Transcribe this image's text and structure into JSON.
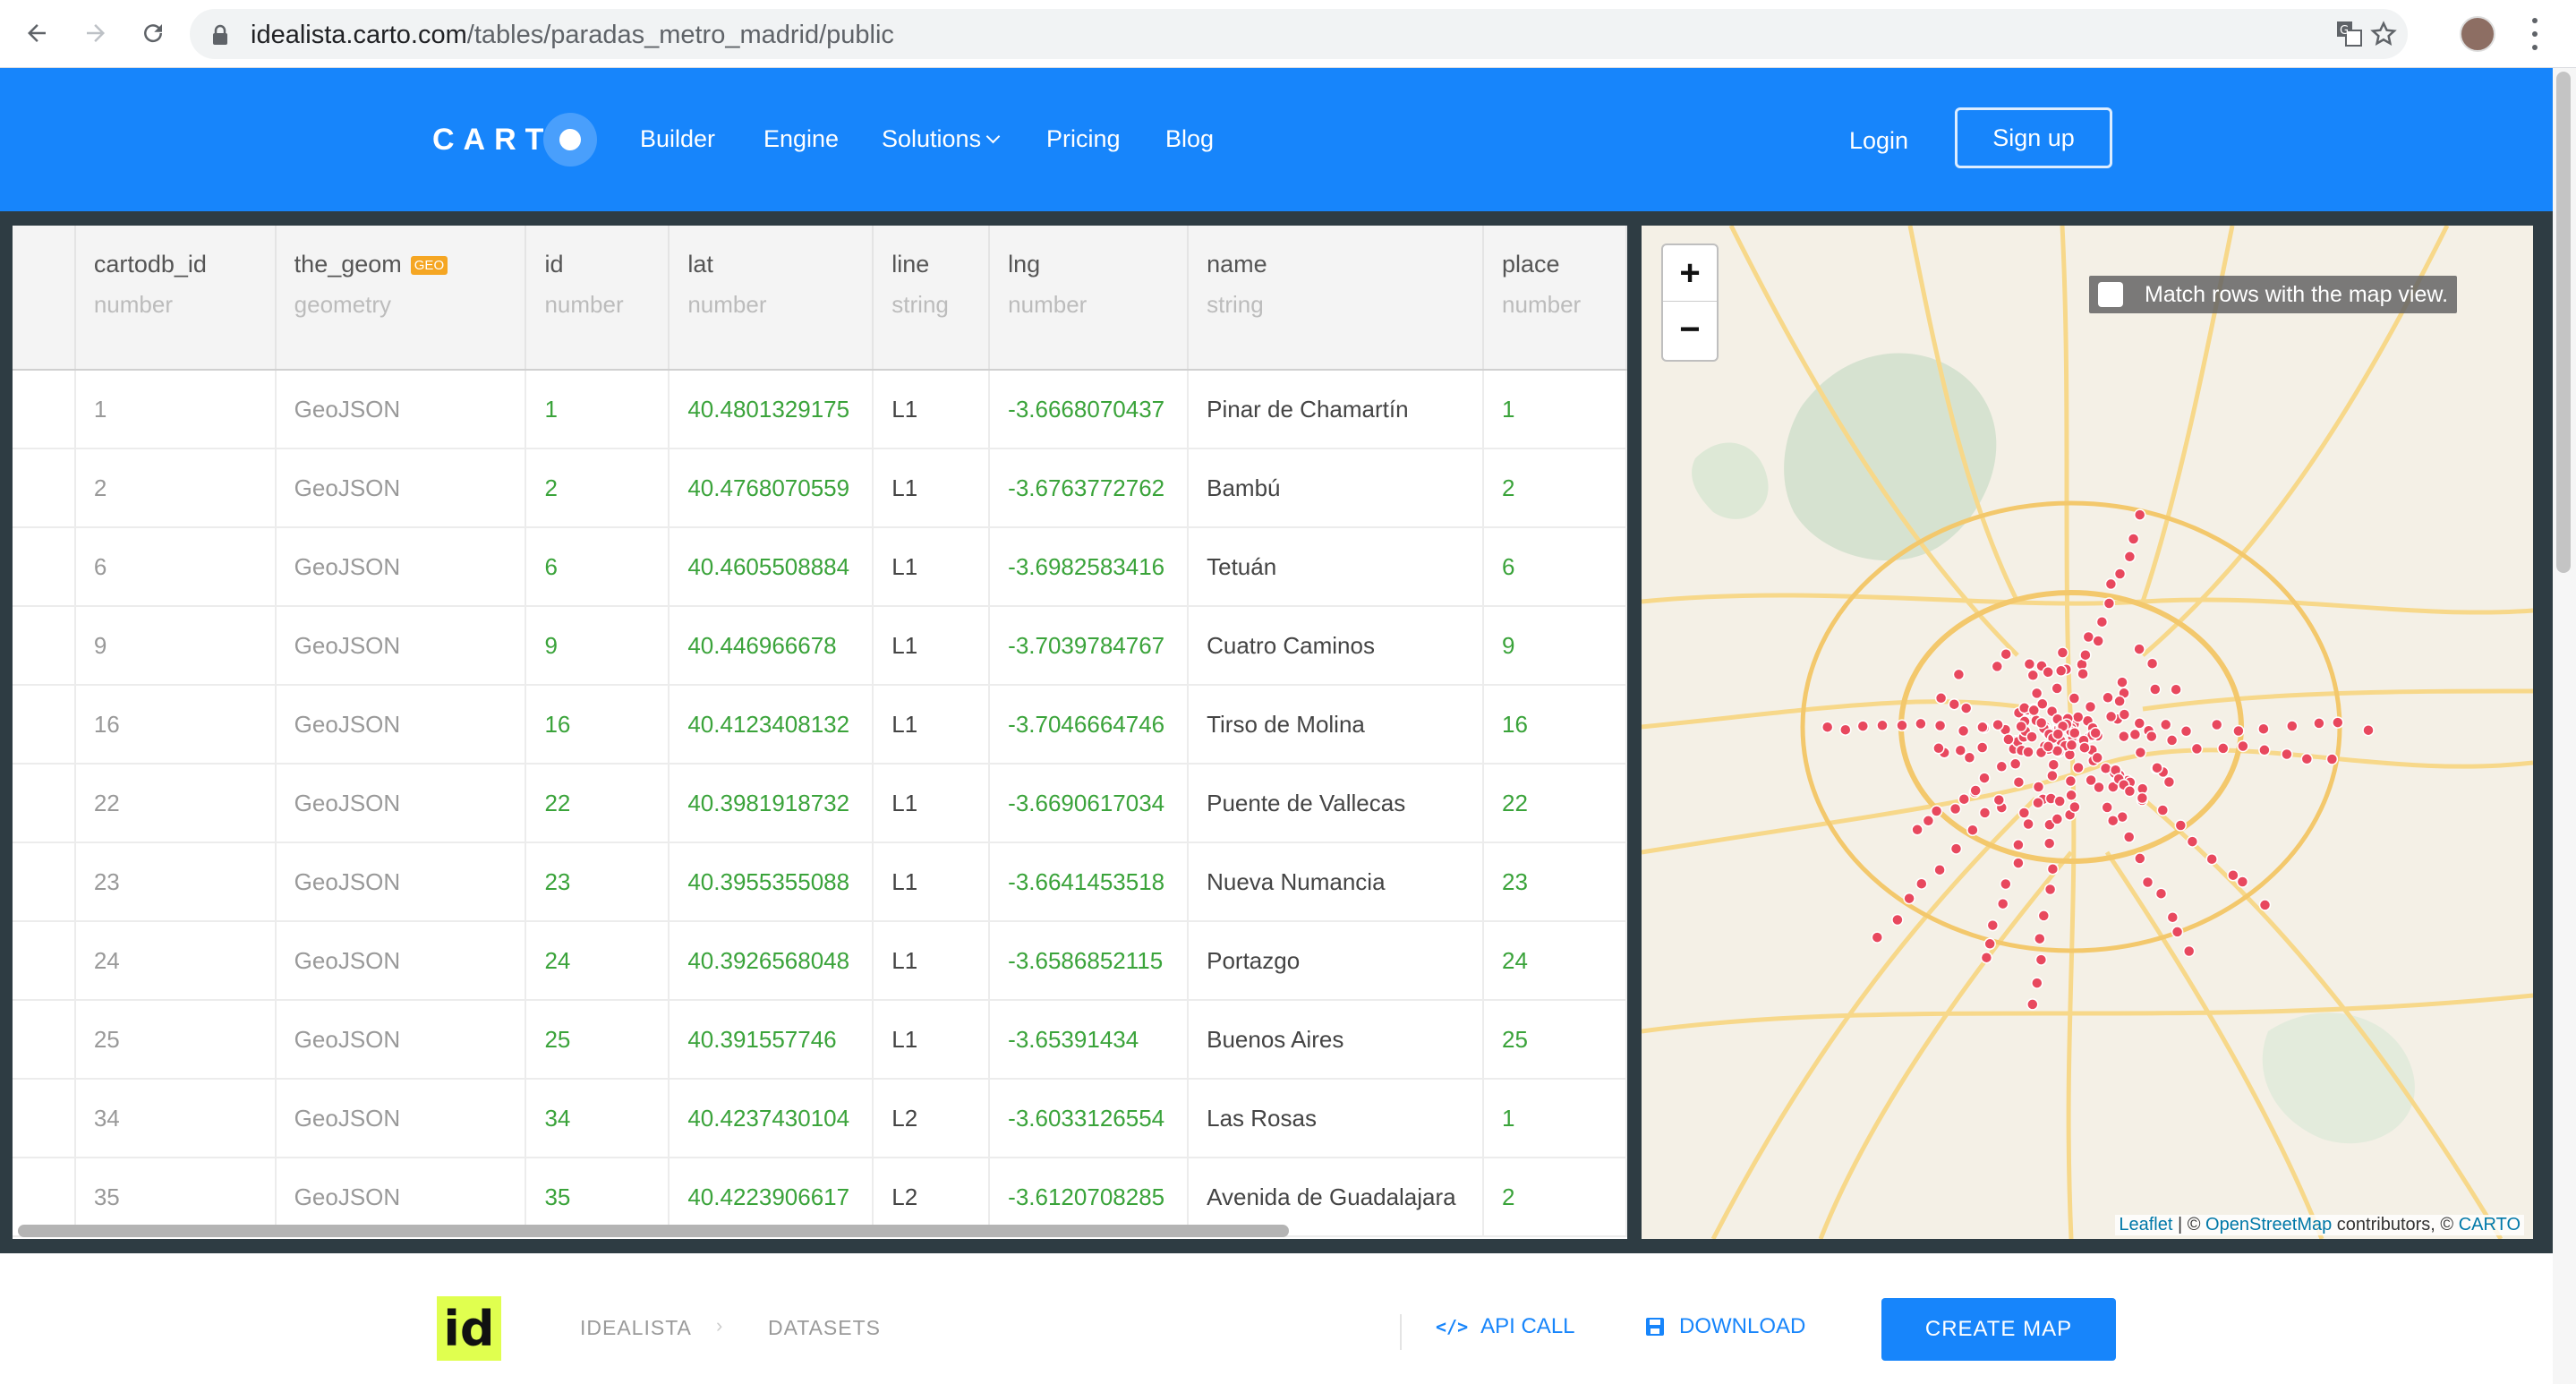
{
  "browser": {
    "url_host": "idealista.carto.com",
    "url_path": "/tables/paradas_metro_madrid/public",
    "icons": [
      "back-icon",
      "forward-icon",
      "reload-icon",
      "lock-icon",
      "translate-icon",
      "star-icon",
      "avatar",
      "menu-icon"
    ]
  },
  "header": {
    "logo_text": "CART",
    "nav": [
      "Builder",
      "Engine",
      "Solutions",
      "Pricing",
      "Blog"
    ],
    "login": "Login",
    "signup": "Sign up"
  },
  "table": {
    "columns": [
      {
        "name": "cartodb_id",
        "type": "number"
      },
      {
        "name": "the_geom",
        "type": "geometry",
        "tag": "GEO"
      },
      {
        "name": "id",
        "type": "number"
      },
      {
        "name": "lat",
        "type": "number"
      },
      {
        "name": "line",
        "type": "string"
      },
      {
        "name": "lng",
        "type": "number"
      },
      {
        "name": "name",
        "type": "string"
      },
      {
        "name": "place",
        "type": "number"
      }
    ],
    "rows": [
      [
        "1",
        "GeoJSON",
        "1",
        "40.4801329175",
        "L1",
        "-3.6668070437",
        "Pinar de Chamartín",
        "1"
      ],
      [
        "2",
        "GeoJSON",
        "2",
        "40.4768070559",
        "L1",
        "-3.6763772762",
        "Bambú",
        "2"
      ],
      [
        "6",
        "GeoJSON",
        "6",
        "40.4605508884",
        "L1",
        "-3.6982583416",
        "Tetuán",
        "6"
      ],
      [
        "9",
        "GeoJSON",
        "9",
        "40.446966678",
        "L1",
        "-3.7039784767",
        "Cuatro Caminos",
        "9"
      ],
      [
        "16",
        "GeoJSON",
        "16",
        "40.4123408132",
        "L1",
        "-3.7046664746",
        "Tirso de Molina",
        "16"
      ],
      [
        "22",
        "GeoJSON",
        "22",
        "40.3981918732",
        "L1",
        "-3.6690617034",
        "Puente de Vallecas",
        "22"
      ],
      [
        "23",
        "GeoJSON",
        "23",
        "40.3955355088",
        "L1",
        "-3.6641453518",
        "Nueva Numancia",
        "23"
      ],
      [
        "24",
        "GeoJSON",
        "24",
        "40.3926568048",
        "L1",
        "-3.6586852115",
        "Portazgo",
        "24"
      ],
      [
        "25",
        "GeoJSON",
        "25",
        "40.391557746",
        "L1",
        "-3.65391434",
        "Buenos Aires",
        "25"
      ],
      [
        "34",
        "GeoJSON",
        "34",
        "40.4237430104",
        "L2",
        "-3.6033126554",
        "Las Rosas",
        "1"
      ],
      [
        "35",
        "GeoJSON",
        "35",
        "40.4223906617",
        "L2",
        "-3.6120708285",
        "Avenida de Guadalajara",
        "2"
      ]
    ]
  },
  "map": {
    "zoom_in": "+",
    "zoom_out": "−",
    "match_label": "Match rows with the map view.",
    "attr_leaflet": "Leaflet",
    "attr_sep1": " | © ",
    "attr_osm": "OpenStreetMap",
    "attr_mid": " contributors, © ",
    "attr_carto": "CARTO",
    "marker_color": "#e8485e"
  },
  "footer": {
    "logo": "id",
    "crumb1": "IDEALISTA",
    "crumb_sep": "›",
    "crumb2": "DATASETS",
    "api_icon": "</>",
    "api_call": "API CALL",
    "download": "DOWNLOAD",
    "create_map": "CREATE MAP"
  },
  "colors": {
    "brand": "#1785fb",
    "data_green": "#3aa33a",
    "geo_tag": "#f5a623"
  }
}
